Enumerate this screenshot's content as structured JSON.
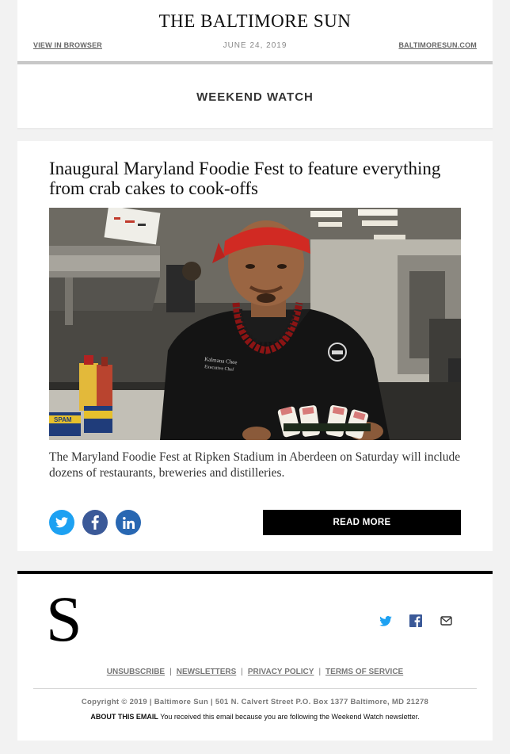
{
  "header": {
    "masthead": "THE BALTIMORE SUN",
    "view_in_browser": "VIEW IN BROWSER",
    "date": "JUNE 24, 2019",
    "site_link": "BALTIMORESUN.COM"
  },
  "section": {
    "title": "WEEKEND WATCH"
  },
  "article": {
    "headline": "Inaugural Maryland Foodie Fest to feature everything from crab cakes to cook-offs",
    "summary": "The Maryland Foodie Fest at Ripken Stadium in Aberdeen on Saturday will include dozens of restaurants, breweries and distilleries.",
    "image": {
      "jacket_text_line1": "Kalmana Chee",
      "jacket_text_line2": "Executive Chef",
      "can_label": "SPAM"
    },
    "share_icons": [
      "twitter-icon",
      "facebook-icon",
      "linkedin-icon"
    ],
    "read_more_label": "READ MORE"
  },
  "footer": {
    "logo_letter": "S",
    "icons": [
      "twitter-icon",
      "facebook-icon",
      "mail-icon"
    ],
    "links": [
      "UNSUBSCRIBE",
      "NEWSLETTERS",
      "PRIVACY POLICY",
      "TERMS OF SERVICE"
    ],
    "copyright": "Copyright © 2019 | Baltimore Sun | 501 N. Calvert Street P.O. Box 1377 Baltimore, MD 21278",
    "about_label": "ABOUT THIS EMAIL",
    "about_text": "You received this email because you are following the Weekend Watch newsletter."
  },
  "colors": {
    "background": "#f2f2f2",
    "twitter": "#1da1f2",
    "facebook": "#3b5998",
    "linkedin": "#2867b2",
    "footer_twitter": "#1da1f2",
    "footer_facebook": "#3b5998",
    "button": "#000000"
  }
}
